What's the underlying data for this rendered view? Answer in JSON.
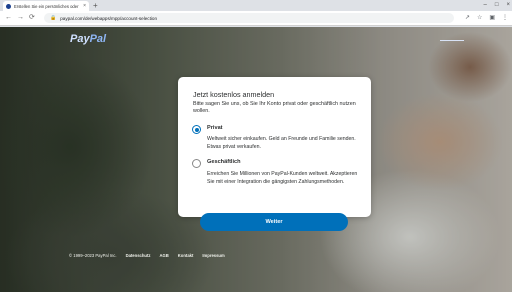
{
  "browser": {
    "tab_title": "Erstellen Sie ein persönliches oder",
    "tab_close": "×",
    "new_tab": "+",
    "url": "paypal.com/de/webapps/mpp/account-selection",
    "win_min": "–",
    "win_max": "□",
    "win_close": "×",
    "nav_back": "←",
    "nav_forward": "→",
    "nav_reload": "⟳",
    "icon_share": "↗",
    "icon_star": "☆",
    "icon_ext": "▣",
    "icon_menu": "⋮"
  },
  "header": {
    "logo_pay": "Pay",
    "logo_pal": "Pal"
  },
  "card": {
    "title": "Jetzt kostenlos anmelden",
    "subtitle": "Bitte sagen Sie uns, ob Sie Ihr Konto privat oder geschäftlich nutzen wollen.",
    "options": [
      {
        "label": "Privat",
        "selected": true,
        "description": "Weltweit sicher einkaufen. Geld an Freunde und Familie senden. Etwas privat verkaufen."
      },
      {
        "label": "Geschäftlich",
        "selected": false,
        "description": "Erreichen Sie Millionen von PayPal-Kunden weltweit. Akzeptieren Sie mit einer Integration die gängigsten Zahlungsmethoden."
      }
    ],
    "button_label": "Weiter"
  },
  "footer": {
    "copyright": "© 1999–2023 PayPal Inc.",
    "links": [
      "Datenschutz",
      "AGB",
      "Kontakt",
      "Impressum"
    ]
  },
  "colors": {
    "accent": "#0070ba"
  }
}
